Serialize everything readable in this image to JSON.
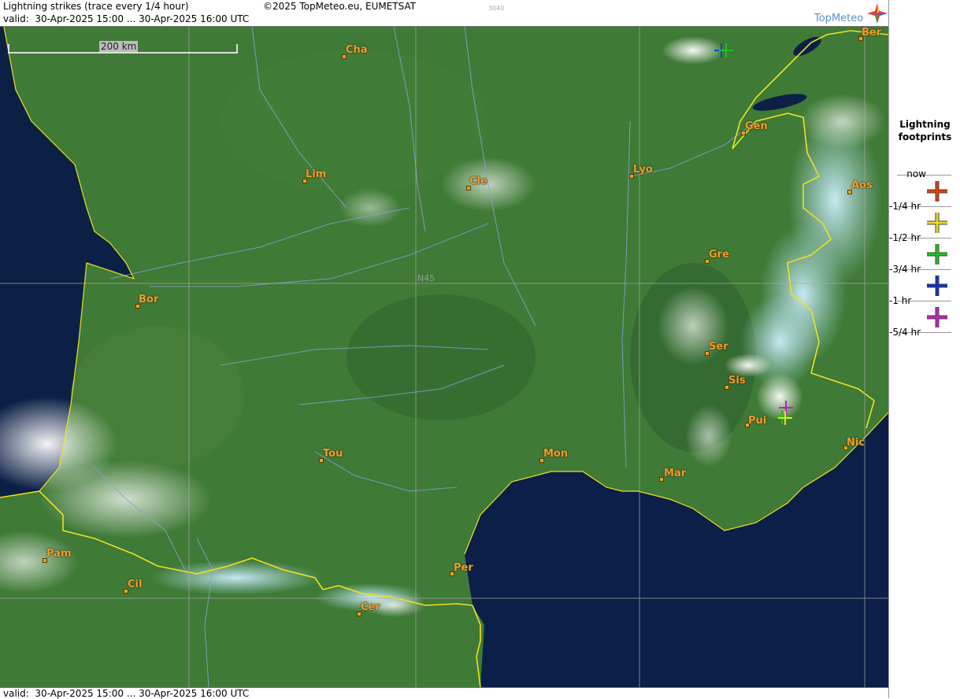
{
  "header": {
    "title": "Lightning strikes (trace every 1/4 hour)",
    "copyright": "©2025 TopMeteo.eu, EUMETSAT",
    "code": "3040",
    "valid": "valid:  30-Apr-2025 15:00 ... 30-Apr-2025 16:00 UTC",
    "logo_text": "TopMeteo"
  },
  "footer": {
    "valid": "valid:  30-Apr-2025 15:00 ... 30-Apr-2025 16:00 UTC"
  },
  "map": {
    "scale_label": "200 km",
    "grid_label": "N45",
    "cities": [
      "Cha",
      "Ber",
      "Gen",
      "Lim",
      "Cle",
      "Lyo",
      "Aos",
      "Gre",
      "Bor",
      "Ser",
      "Sis",
      "Pui",
      "Tou",
      "Mon",
      "Mar",
      "Nic",
      "Pam",
      "Cil",
      "Per",
      "Cer"
    ],
    "strikes": [
      {
        "age_hr": -1,
        "color": "#1040d0"
      },
      {
        "age_hr": -0.75,
        "color": "#20c020"
      },
      {
        "age_hr": -1.25,
        "color": "#c020c0"
      },
      {
        "age_hr": -0.75,
        "color": "#20c020"
      },
      {
        "age_hr": -0.5,
        "color": "#e8e020"
      }
    ]
  },
  "legend": {
    "title_line1": "Lightning",
    "title_line2": "footprints",
    "items": [
      {
        "label": "now",
        "color": "#e04010"
      },
      {
        "label": "-1/4 hr",
        "color": "#e8d820"
      },
      {
        "label": "-1/2 hr",
        "color": "#20c020"
      },
      {
        "label": "-3/4 hr",
        "color": "#1030c0"
      },
      {
        "label": "-1 hr",
        "color": "#c020c0"
      },
      {
        "label": "-5/4 hr",
        "color": ""
      }
    ]
  }
}
